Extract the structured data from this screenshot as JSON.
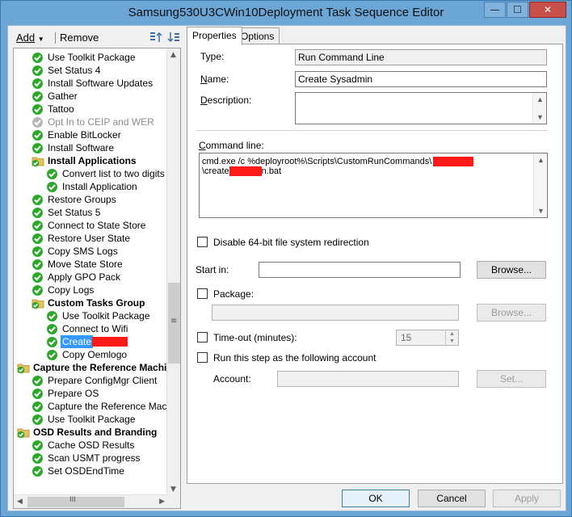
{
  "window": {
    "title": "Samsung530U3CWin10Deployment Task Sequence Editor",
    "controls": {
      "minimize": "—",
      "maximize": "☐",
      "close": "✕"
    }
  },
  "toolbar": {
    "add_label": "Add",
    "remove_label": "Remove",
    "icon1": "move-up-icon",
    "icon2": "move-down-icon"
  },
  "tree": {
    "items": [
      {
        "label": "Use Toolkit Package",
        "level": 1,
        "type": "step",
        "state": "ok"
      },
      {
        "label": "Set Status 4",
        "level": 1,
        "type": "step",
        "state": "ok"
      },
      {
        "label": "Install Software Updates",
        "level": 1,
        "type": "step",
        "state": "ok"
      },
      {
        "label": "Gather",
        "level": 1,
        "type": "step",
        "state": "ok"
      },
      {
        "label": "Tattoo",
        "level": 1,
        "type": "step",
        "state": "ok"
      },
      {
        "label": "Opt In to CEIP and WER",
        "level": 1,
        "type": "step",
        "state": "disabled"
      },
      {
        "label": "Enable BitLocker",
        "level": 1,
        "type": "step",
        "state": "ok"
      },
      {
        "label": "Install Software",
        "level": 1,
        "type": "step",
        "state": "ok"
      },
      {
        "label": "Install Applications",
        "level": 1,
        "type": "group",
        "state": "ok"
      },
      {
        "label": "Convert list to two digits",
        "level": 2,
        "type": "step",
        "state": "ok"
      },
      {
        "label": "Install Application",
        "level": 2,
        "type": "step",
        "state": "ok"
      },
      {
        "label": "Restore Groups",
        "level": 1,
        "type": "step",
        "state": "ok"
      },
      {
        "label": "Set Status 5",
        "level": 1,
        "type": "step",
        "state": "ok"
      },
      {
        "label": "Connect to State Store",
        "level": 1,
        "type": "step",
        "state": "ok"
      },
      {
        "label": "Restore User State",
        "level": 1,
        "type": "step",
        "state": "ok"
      },
      {
        "label": "Copy SMS Logs",
        "level": 1,
        "type": "step",
        "state": "ok"
      },
      {
        "label": "Move State Store",
        "level": 1,
        "type": "step",
        "state": "ok"
      },
      {
        "label": "Apply GPO Pack",
        "level": 1,
        "type": "step",
        "state": "ok"
      },
      {
        "label": "Copy Logs",
        "level": 1,
        "type": "step",
        "state": "ok"
      },
      {
        "label": "Custom Tasks Group",
        "level": 1,
        "type": "group",
        "state": "ok"
      },
      {
        "label": "Use Toolkit Package",
        "level": 2,
        "type": "step",
        "state": "ok"
      },
      {
        "label": "Connect to Wifi",
        "level": 2,
        "type": "step",
        "state": "ok"
      },
      {
        "label": "Create",
        "level": 2,
        "type": "step",
        "state": "selected"
      },
      {
        "label": "Copy Oemlogo",
        "level": 2,
        "type": "step",
        "state": "ok"
      },
      {
        "label": "Capture the Reference Machi",
        "level": 0,
        "type": "group",
        "state": "ok"
      },
      {
        "label": "Prepare ConfigMgr Client",
        "level": 1,
        "type": "step",
        "state": "ok"
      },
      {
        "label": "Prepare OS",
        "level": 1,
        "type": "step",
        "state": "ok"
      },
      {
        "label": "Capture the Reference Machine",
        "level": 1,
        "type": "step",
        "state": "ok"
      },
      {
        "label": "Use Toolkit Package",
        "level": 1,
        "type": "step",
        "state": "ok"
      },
      {
        "label": "OSD Results and Branding",
        "level": 0,
        "type": "group",
        "state": "ok"
      },
      {
        "label": "Cache OSD Results",
        "level": 1,
        "type": "step",
        "state": "ok"
      },
      {
        "label": "Scan USMT progress",
        "level": 1,
        "type": "step",
        "state": "ok"
      },
      {
        "label": "Set OSDEndTime",
        "level": 1,
        "type": "step",
        "state": "ok"
      }
    ],
    "hscroll_glyph": "III",
    "vscroll_glyph": "≡"
  },
  "tabs": {
    "properties": "Properties",
    "options": "Options"
  },
  "props": {
    "type_label": "Type:",
    "type_value": "Run Command Line",
    "name_label": "Name:",
    "name_value": "Create Sysadmin",
    "description_label": "Description:",
    "description_value": "",
    "command_label": "Command line:",
    "command_line1": "cmd.exe /c %deployroot%\\Scripts\\CustomRunCommands\\",
    "command_line2_a": "\\create",
    "command_line2_b": "n.bat",
    "disable64_label": "Disable 64-bit file system redirection",
    "startin_label": "Start in:",
    "startin_value": "",
    "browse1": "Browse...",
    "package_label": "Package:",
    "package_value": "",
    "browse2": "Browse...",
    "timeout_label": "Time-out (minutes):",
    "timeout_value": "15",
    "runas_label": "Run this step as the following account",
    "account_label": "Account:",
    "account_value": "",
    "set_button": "Set..."
  },
  "footer": {
    "ok": "OK",
    "cancel": "Cancel",
    "apply": "Apply"
  },
  "colors": {
    "check_green": "#2ea82a",
    "selection": "#3399ff",
    "redaction": "#ff1a1a",
    "folder": "#e8c35a"
  }
}
